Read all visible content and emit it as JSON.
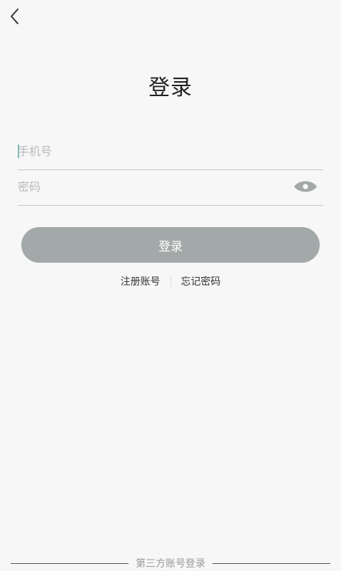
{
  "header": {
    "back_icon": "chevron-left-icon"
  },
  "page": {
    "title": "登录"
  },
  "form": {
    "phone": {
      "value": "",
      "placeholder": "手机号"
    },
    "password": {
      "value": "",
      "placeholder": "密码",
      "toggle_icon": "eye-icon"
    },
    "login_label": "登录"
  },
  "links": {
    "register": "注册账号",
    "forgot": "忘记密码"
  },
  "footer": {
    "third_party_label": "第三方账号登录"
  },
  "colors": {
    "background": "#f7f7f7",
    "button": "#a3a8a8",
    "caret": "#7fb8b2"
  }
}
